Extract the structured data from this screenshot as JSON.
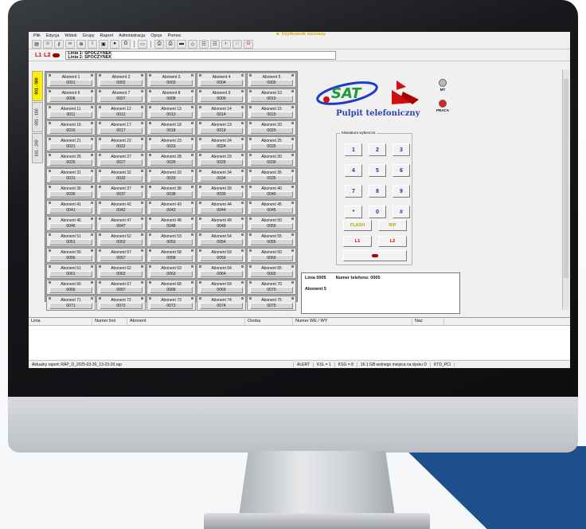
{
  "menu": {
    "items": [
      "Plik",
      "Edycja",
      "Widok",
      "Grupy",
      "Raport",
      "Administracja",
      "Opcje",
      "Pomoc"
    ],
    "user_message": "Użytkownik nieznany"
  },
  "lines": {
    "l1": "L1",
    "l2": "L2",
    "line1": "Linia 1: SPOCZYNEK",
    "line2": "Linia 2: SPOCZYNEK"
  },
  "tabs": [
    "001 - 080",
    "081 - 160",
    "161 - 240"
  ],
  "subscribers": [
    {
      "name": "Abonent 1",
      "number": "0001"
    },
    {
      "name": "Abonent 2",
      "number": "0002"
    },
    {
      "name": "Abonent 3",
      "number": "0003"
    },
    {
      "name": "Abonent 4",
      "number": "0004"
    },
    {
      "name": "Abonent 5",
      "number": "0005"
    },
    {
      "name": "Abonent 6",
      "number": "0006"
    },
    {
      "name": "Abonent 7",
      "number": "0007"
    },
    {
      "name": "Abonent 8",
      "number": "0008"
    },
    {
      "name": "Abonent 9",
      "number": "0009"
    },
    {
      "name": "Abonent 10",
      "number": "0010"
    },
    {
      "name": "Abonent 11",
      "number": "0011"
    },
    {
      "name": "Abonent 12",
      "number": "0012"
    },
    {
      "name": "Abonent 13",
      "number": "0013"
    },
    {
      "name": "Abonent 14",
      "number": "0014"
    },
    {
      "name": "Abonent 15",
      "number": "0015"
    },
    {
      "name": "Abonent 16",
      "number": "0016"
    },
    {
      "name": "Abonent 17",
      "number": "0017"
    },
    {
      "name": "Abonent 18",
      "number": "0018"
    },
    {
      "name": "Abonent 19",
      "number": "0019"
    },
    {
      "name": "Abonent 20",
      "number": "0020"
    },
    {
      "name": "Abonent 21",
      "number": "0021"
    },
    {
      "name": "Abonent 22",
      "number": "0022"
    },
    {
      "name": "Abonent 23",
      "number": "0023"
    },
    {
      "name": "Abonent 24",
      "number": "0024"
    },
    {
      "name": "Abonent 25",
      "number": "0025"
    },
    {
      "name": "Abonent 26",
      "number": "0026"
    },
    {
      "name": "Abonent 27",
      "number": "0027"
    },
    {
      "name": "Abonent 28",
      "number": "0028"
    },
    {
      "name": "Abonent 29",
      "number": "0029"
    },
    {
      "name": "Abonent 30",
      "number": "0030"
    },
    {
      "name": "Abonent 31",
      "number": "0031"
    },
    {
      "name": "Abonent 32",
      "number": "0032"
    },
    {
      "name": "Abonent 33",
      "number": "0033"
    },
    {
      "name": "Abonent 34",
      "number": "0034"
    },
    {
      "name": "Abonent 35",
      "number": "0035"
    },
    {
      "name": "Abonent 36",
      "number": "0036"
    },
    {
      "name": "Abonent 37",
      "number": "0037"
    },
    {
      "name": "Abonent 38",
      "number": "0038"
    },
    {
      "name": "Abonent 39",
      "number": "0039"
    },
    {
      "name": "Abonent 40",
      "number": "0040"
    },
    {
      "name": "Abonent 41",
      "number": "0041"
    },
    {
      "name": "Abonent 42",
      "number": "0042"
    },
    {
      "name": "Abonent 43",
      "number": "0043"
    },
    {
      "name": "Abonent 44",
      "number": "0044"
    },
    {
      "name": "Abonent 45",
      "number": "0045"
    },
    {
      "name": "Abonent 46",
      "number": "0046"
    },
    {
      "name": "Abonent 47",
      "number": "0047"
    },
    {
      "name": "Abonent 48",
      "number": "0048"
    },
    {
      "name": "Abonent 49",
      "number": "0049"
    },
    {
      "name": "Abonent 50",
      "number": "0050"
    },
    {
      "name": "Abonent 51",
      "number": "0051"
    },
    {
      "name": "Abonent 52",
      "number": "0052"
    },
    {
      "name": "Abonent 53",
      "number": "0053"
    },
    {
      "name": "Abonent 54",
      "number": "0054"
    },
    {
      "name": "Abonent 55",
      "number": "0055"
    },
    {
      "name": "Abonent 56",
      "number": "0056"
    },
    {
      "name": "Abonent 57",
      "number": "0057"
    },
    {
      "name": "Abonent 58",
      "number": "0058"
    },
    {
      "name": "Abonent 59",
      "number": "0059"
    },
    {
      "name": "Abonent 60",
      "number": "0060"
    },
    {
      "name": "Abonent 61",
      "number": "0061"
    },
    {
      "name": "Abonent 62",
      "number": "0062"
    },
    {
      "name": "Abonent 63",
      "number": "0063"
    },
    {
      "name": "Abonent 64",
      "number": "0064"
    },
    {
      "name": "Abonent 65",
      "number": "0065"
    },
    {
      "name": "Abonent 66",
      "number": "0066"
    },
    {
      "name": "Abonent 67",
      "number": "0067"
    },
    {
      "name": "Abonent 68",
      "number": "0068"
    },
    {
      "name": "Abonent 69",
      "number": "0069"
    },
    {
      "name": "Abonent 70",
      "number": "0070"
    },
    {
      "name": "Abonent 71",
      "number": "0071"
    },
    {
      "name": "Abonent 72",
      "number": "0072"
    },
    {
      "name": "Abonent 73",
      "number": "0073"
    },
    {
      "name": "Abonent 74",
      "number": "0074"
    },
    {
      "name": "Abonent 75",
      "number": "0075"
    }
  ],
  "panel": {
    "logo_text": "SAT",
    "title": "Pulpit telefoniczny",
    "indicator_mt": "MT",
    "indicator_praca": "PRACA",
    "keypad_legend": "Klawiatura wybiercza",
    "keys": [
      "1",
      "2",
      "3",
      "4",
      "5",
      "6",
      "7",
      "8",
      "9",
      "*",
      "0",
      "#"
    ],
    "flash": "FLASH",
    "rp": "R/P",
    "l1": "L1",
    "l2": "L2"
  },
  "info": {
    "line": "Linia 0005",
    "phone": "Numer telefonu: 0005",
    "subscriber": "Abonent 5"
  },
  "table": {
    "columns": [
      "Linia",
      "Numer linii",
      "Abonent",
      "Osoba",
      "Numer WE / WY",
      "Naz"
    ]
  },
  "status": {
    "report": "Aktualny raport: RAP_D_2025-03-30_13-23-26.rap",
    "alert": "ALERT",
    "ksl": "KSL = 1",
    "ksg": "KSG = 8",
    "disk": "16.1 GB wolnego miejsca na dysku D",
    "ktd": "KTD_PCI"
  },
  "colors": {
    "active_tab": "#ffef00",
    "keypad_digits": "#1a36a6",
    "title": "#2842b8",
    "alert_red": "#d10000",
    "indicator_praca": "#e02020"
  }
}
